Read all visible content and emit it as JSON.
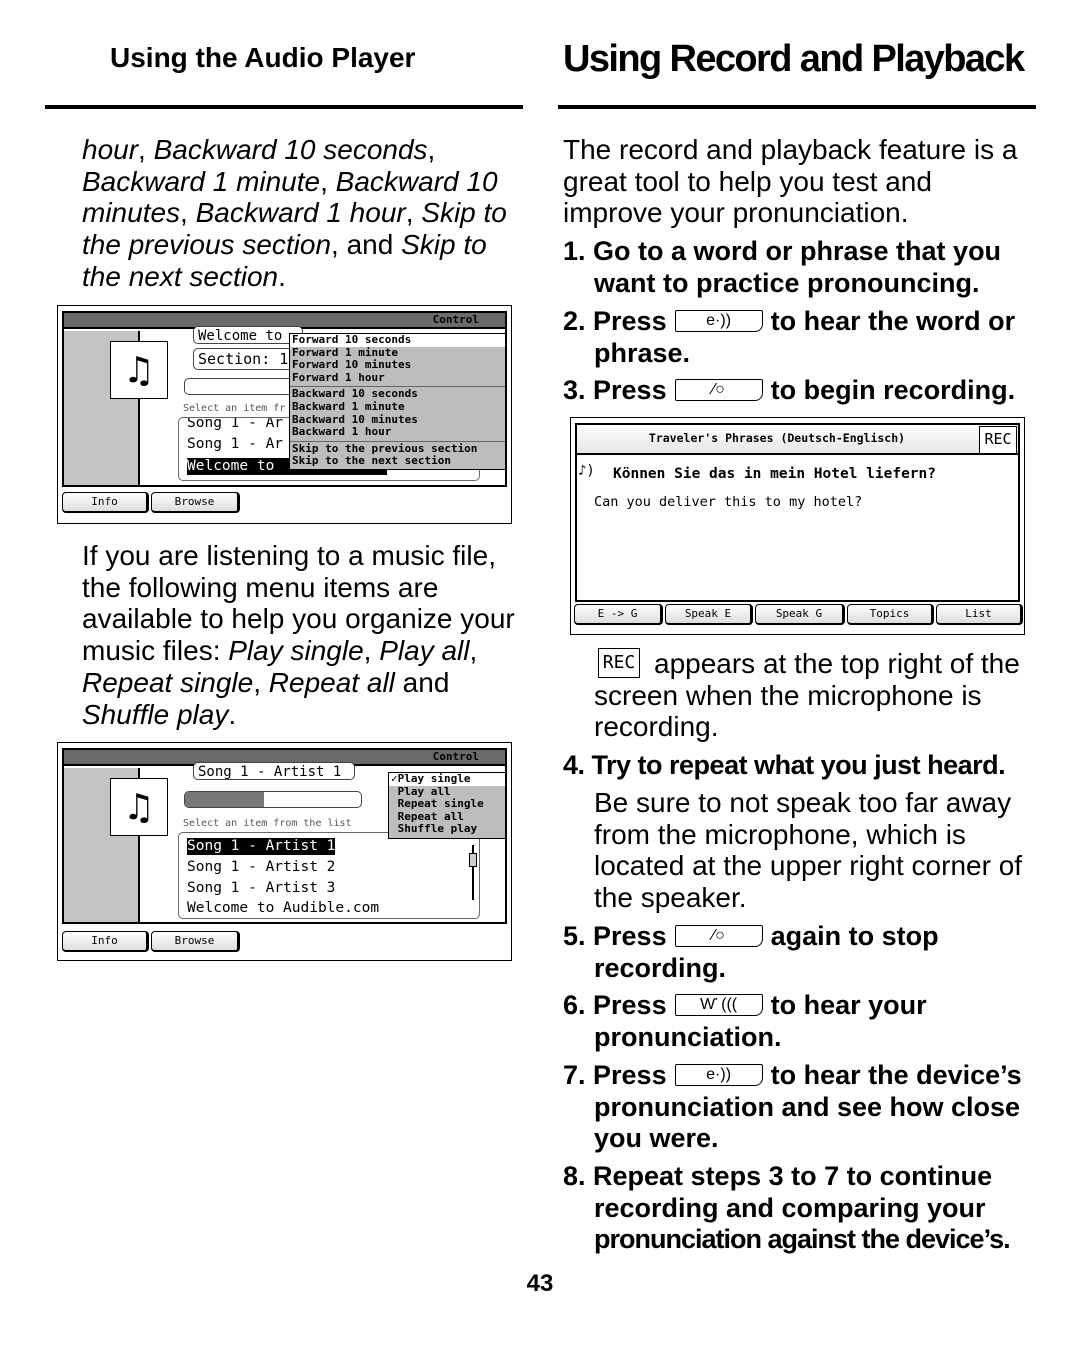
{
  "left": {
    "heading": "Using the Audio Player",
    "para1": [
      {
        "t": "hour",
        "i": true
      },
      {
        "t": ", ",
        "i": false
      },
      {
        "t": "Backward 10 seconds",
        "i": true
      },
      {
        "t": ", ",
        "i": false
      },
      {
        "t": "Backward 1 minute",
        "i": true
      },
      {
        "t": ", ",
        "i": false
      },
      {
        "t": "Backward 10 minutes",
        "i": true
      },
      {
        "t": ", ",
        "i": false
      },
      {
        "t": "Backward 1 hour",
        "i": true
      },
      {
        "t": ", ",
        "i": false
      },
      {
        "t": "Skip to the previous section",
        "i": true
      },
      {
        "t": ", and ",
        "i": false
      },
      {
        "t": "Skip to the next section",
        "i": true
      },
      {
        "t": ".",
        "i": false
      }
    ],
    "para2": [
      {
        "t": "If you are listening to a music file, the following menu items are available to help you organize your music files: ",
        "i": false
      },
      {
        "t": "Play single",
        "i": true
      },
      {
        "t": ", ",
        "i": false
      },
      {
        "t": "Play all",
        "i": true
      },
      {
        "t": ", ",
        "i": false
      },
      {
        "t": "Repeat single",
        "i": true
      },
      {
        "t": ", ",
        "i": false
      },
      {
        "t": "Repeat all",
        "i": true
      },
      {
        "t": " and ",
        "i": false
      },
      {
        "t": "Shuffle play",
        "i": true
      },
      {
        "t": ".",
        "i": false
      }
    ],
    "screen1": {
      "menu_title": "Control",
      "field_top": "Welcome to",
      "field_section": "Section: 1",
      "select_label": "Select an item fr",
      "list": [
        "Song 1 - Ar",
        "Song 1 - Ar",
        "Welcome to"
      ],
      "menu_groups": [
        [
          "Forward 10 seconds",
          "Forward 1 minute",
          "Forward 10 minutes",
          "Forward 1 hour"
        ],
        [
          "Backward 10 seconds",
          "Backward 1 minute",
          "Backward 10 minutes",
          "Backward 1 hour"
        ],
        [
          "Skip to the previous section",
          "Skip to the next section"
        ]
      ],
      "buttons": [
        "Info",
        "Browse"
      ]
    },
    "screen2": {
      "menu_title": "Control",
      "field_top": "Song 1 - Artist 1",
      "progress_percent": 45,
      "select_label": "Select an item from the list",
      "list": [
        "Song 1 - Artist 1",
        "Song 1 - Artist 2",
        "Song 1 - Artist 3",
        "Welcome to Audible.com"
      ],
      "menu": [
        "✓Play single",
        " Play all",
        " Repeat single",
        " Repeat all",
        " Shuffle play"
      ],
      "buttons": [
        "Info",
        "Browse"
      ]
    }
  },
  "right": {
    "heading": "Using Record and Playback",
    "intro": "The record and playback feature is a great tool to help you test and improve your pronunciation.",
    "step1": "1. Go to a word or phrase that you want to practice pronouncing.",
    "step2a": "2. Press",
    "step2b": "to hear the word or phrase.",
    "step3a": "3. Press",
    "step3b": "to begin recording.",
    "screen3": {
      "title": "Traveler's Phrases (Deutsch-Englisch)",
      "rec": "REC",
      "phrase": "Können Sie das in mein Hotel liefern?",
      "translation": "Can you deliver this to my hotel?",
      "buttons": [
        "E -> G",
        "Speak E",
        "Speak G",
        "Topics",
        "List"
      ]
    },
    "rec_badge": "REC",
    "rec_note": "appears at the top right of the screen when the microphone is recording.",
    "step4": "4. Try to repeat what you just heard.",
    "step4_body": "Be sure to not speak too far away from the microphone, which is located at the upper right corner of the speaker.",
    "step5a": "5. Press",
    "step5b": "again to stop recording.",
    "step6a": "6. Press",
    "step6b": "to hear your pronunciation.",
    "step7a": "7. Press",
    "step7b": "to hear the device’s pronunciation and see how close you were.",
    "step8a": "8. Repeat steps 3 to 7 to continue recording and comparing your",
    "step8b": "pronunciation against the device’s.",
    "keys": {
      "speaker": "e·))",
      "record": "∕○",
      "playback": "Ⱳ ((("
    }
  },
  "page_number": "43"
}
